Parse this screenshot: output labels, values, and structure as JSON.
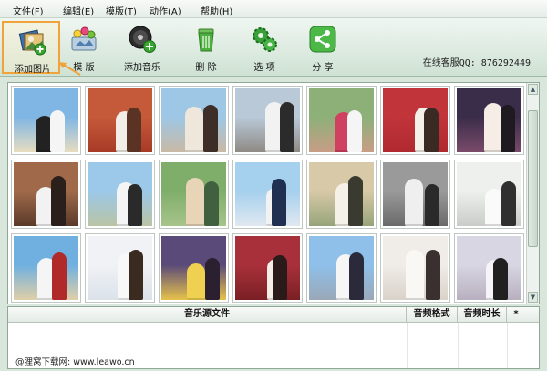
{
  "menu": [
    {
      "id": "file",
      "label": "文件(F)"
    },
    {
      "id": "edit",
      "label": "编辑(E)"
    },
    {
      "id": "template",
      "label": "模版(T)"
    },
    {
      "id": "action",
      "label": "动作(A)"
    },
    {
      "id": "help",
      "label": "帮助(H)"
    }
  ],
  "toolbar": {
    "add_image": {
      "label": "添加图片",
      "icon": "add-image-icon"
    },
    "template": {
      "label": "模 版",
      "icon": "template-icon"
    },
    "add_music": {
      "label": "添加音乐",
      "icon": "add-music-icon"
    },
    "delete": {
      "label": "删 除",
      "icon": "trash-icon"
    },
    "options": {
      "label": "选 项",
      "icon": "gears-icon"
    },
    "share": {
      "label": "分 享",
      "icon": "share-icon"
    },
    "online_service": "在线客服QQ: 876292449"
  },
  "colors": {
    "accent": "#f0a33a",
    "toolbar_green": "#cfe2d4",
    "border": "#8ea796"
  },
  "gallery": {
    "photos": [
      {
        "scene": "beach couple",
        "sky": "#7fb6e4",
        "ground": "#e8dcc0",
        "a": "#222",
        "b": "#f5f5f5"
      },
      {
        "scene": "red hall couple",
        "sky": "#c45a3a",
        "ground": "#a83a26",
        "a": "#f3efe8",
        "b": "#5a3324"
      },
      {
        "scene": "bride with hat",
        "sky": "#9ec7e6",
        "ground": "#c9b9a4",
        "a": "#efe7dc",
        "b": "#3d2f28"
      },
      {
        "scene": "castle couple",
        "sky": "#b9c9d8",
        "ground": "#8e8a84",
        "a": "#f2f2f2",
        "b": "#2b2b2b"
      },
      {
        "scene": "couple by tree",
        "sky": "#8db079",
        "ground": "#c89d86",
        "a": "#d04060",
        "b": "#f5f5f5"
      },
      {
        "scene": "red decorated hall",
        "sky": "#c0343a",
        "ground": "#b02a30",
        "a": "#f4f0ea",
        "b": "#3a2a24"
      },
      {
        "scene": "night castle",
        "sky": "#3a2d4a",
        "ground": "#7a4a6a",
        "a": "#f6eee6",
        "b": "#1f1a20"
      },
      {
        "scene": "dark suit couple",
        "sky": "#a06a4a",
        "ground": "#5a3a2a",
        "a": "#f2f2f2",
        "b": "#2a1f1a"
      },
      {
        "scene": "castle day",
        "sky": "#9cc8ea",
        "ground": "#b9c4a4",
        "a": "#f5f5f5",
        "b": "#2a2a2a"
      },
      {
        "scene": "garden bride",
        "sky": "#7fae6a",
        "ground": "#a7c48a",
        "a": "#e8d5b8",
        "b": "#406040"
      },
      {
        "scene": "bicycle couple",
        "sky": "#a5d0ee",
        "ground": "#e0e8f0",
        "a": "#f2f2f2",
        "b": "#203050"
      },
      {
        "scene": "heart frame",
        "sky": "#d8c9a8",
        "ground": "#96a47a",
        "a": "#f5f0e8",
        "b": "#3a3a30"
      },
      {
        "scene": "black and white",
        "sky": "#9a9a9a",
        "ground": "#6a6a6a",
        "a": "#efefef",
        "b": "#2a2a2a"
      },
      {
        "scene": "white veil",
        "sky": "#eef0ee",
        "ground": "#c9ccc9",
        "a": "#fafafa",
        "b": "#303030"
      },
      {
        "scene": "beach umbrella",
        "sky": "#6fb0e0",
        "ground": "#e0cfa8",
        "a": "#f5f5f5",
        "b": "#b02a2a"
      },
      {
        "scene": "bright window",
        "sky": "#f0f2f5",
        "ground": "#dbe2ea",
        "a": "#f8f8f8",
        "b": "#3a2a20"
      },
      {
        "scene": "princess gown",
        "sky": "#5a4a7a",
        "ground": "#e6c24a",
        "a": "#f0d050",
        "b": "#2a2030"
      },
      {
        "scene": "red theatre",
        "sky": "#a8303a",
        "ground": "#7a2024",
        "a": "#f5eee6",
        "b": "#2a1a1a"
      },
      {
        "scene": "castle blue",
        "sky": "#8ec0ea",
        "ground": "#9aa8b8",
        "a": "#f6f6f6",
        "b": "#2a2a3a"
      },
      {
        "scene": "reclining bride",
        "sky": "#f0ece8",
        "ground": "#d9d2ca",
        "a": "#faf8f5",
        "b": "#3a3030"
      },
      {
        "scene": "embrace",
        "sky": "#d8d6e2",
        "ground": "#b8b0c0",
        "a": "#f6f4f8",
        "b": "#202020"
      }
    ]
  },
  "music_table": {
    "columns": [
      "音乐源文件",
      "音频格式",
      "音频时长",
      "*"
    ]
  },
  "watermark": "@狸窝下载网: www.leawo.cn"
}
